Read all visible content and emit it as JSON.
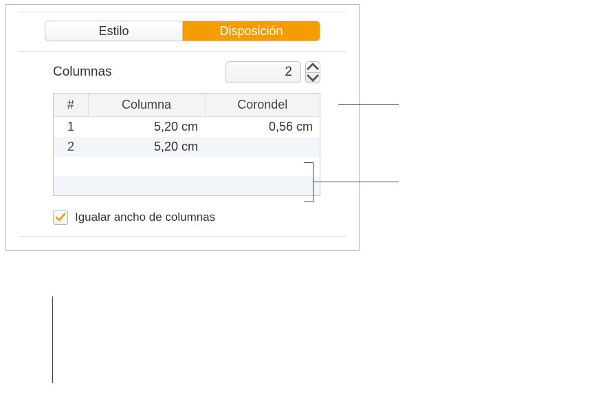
{
  "tabs": {
    "style": "Estilo",
    "layout": "Disposición"
  },
  "columns_section": {
    "label": "Columnas",
    "count": "2"
  },
  "table": {
    "headers": {
      "num": "#",
      "column": "Columna",
      "gutter": "Corondel"
    },
    "rows": [
      {
        "num": "1",
        "column": "5,20 cm",
        "gutter": "0,56 cm"
      },
      {
        "num": "2",
        "column": "5,20 cm",
        "gutter": ""
      }
    ]
  },
  "equal_width": {
    "label": "Igualar ancho de columnas",
    "checked": true
  },
  "colors": {
    "accent": "#f49c00"
  }
}
